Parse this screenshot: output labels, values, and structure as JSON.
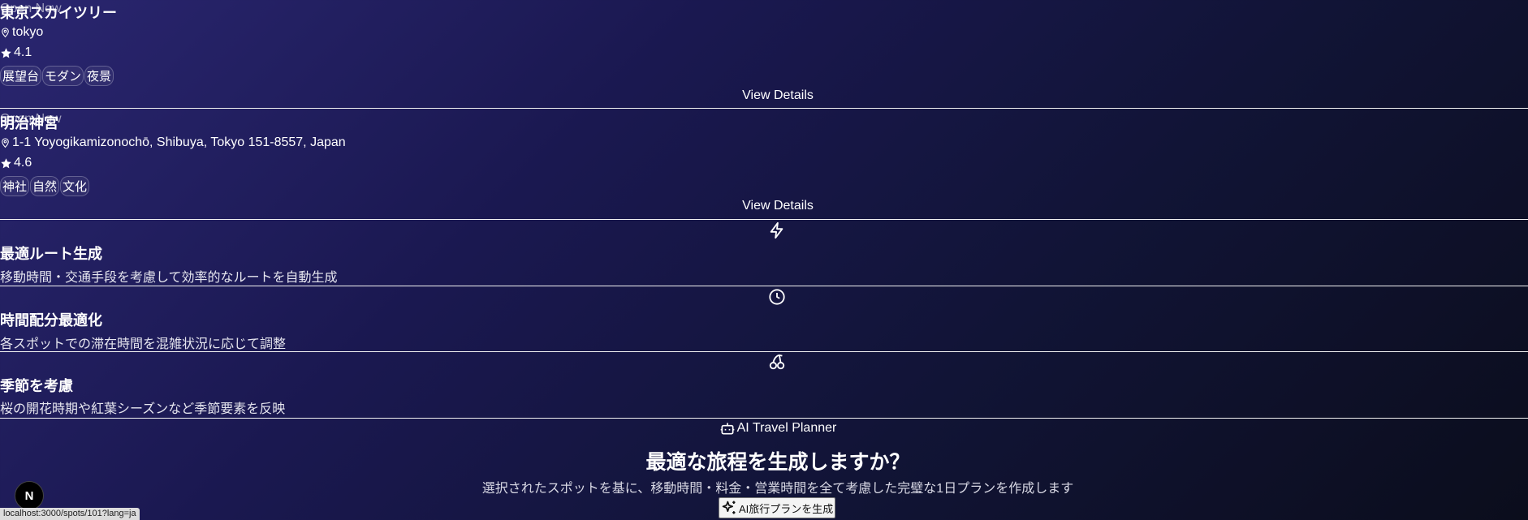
{
  "spots": [
    {
      "status": "Open Now",
      "name": "東京スカイツリー",
      "location": "tokyo",
      "rating": "4.1",
      "tags": [
        "展望台",
        "モダン",
        "夜景"
      ],
      "details_label": "View Details"
    },
    {
      "status": "Open Now",
      "name": "明治神宮",
      "location": "1-1 Yoyogikamizonochō, Shibuya, Tokyo 151-8557, Japan",
      "rating": "4.6",
      "tags": [
        "神社",
        "自然",
        "文化"
      ],
      "details_label": "View Details"
    }
  ],
  "features": [
    {
      "icon": "lightning-icon",
      "title": "最適ルート生成",
      "desc": "移動時間・交通手段を考慮して効率的なルートを自動生成"
    },
    {
      "icon": "clock-icon",
      "title": "時間配分最適化",
      "desc": "各スポットでの滞在時間を混雑状況に応じて調整"
    },
    {
      "icon": "cherry-icon",
      "title": "季節を考慮",
      "desc": "桜の開花時期や紅葉シーズンなど季節要素を反映"
    }
  ],
  "planner": {
    "badge": "AI Travel Planner",
    "heading": "最適な旅程を生成しますか？",
    "subtext": "選択されたスポットを基に、移動時間・料金・営業時間を全て考慮した完璧な1日プランを作成します",
    "button_label": "AI旅行プランを生成"
  },
  "dev_badge": "N",
  "status_url": "localhost:3000/spots/101?lang=ja"
}
